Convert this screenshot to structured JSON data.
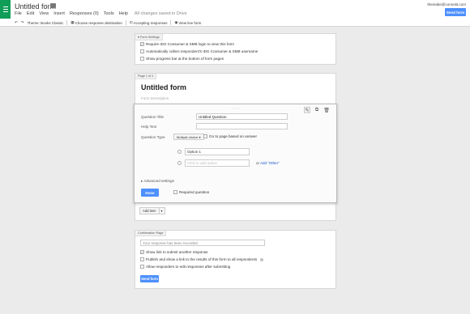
{
  "header": {
    "title": "Untitled form",
    "menu": [
      "File",
      "Edit",
      "View",
      "Insert",
      "Responses (0)",
      "Tools",
      "Help"
    ],
    "saved_status": "All changes saved in Drive",
    "user_email": "themabe@conso5t.com",
    "send_button": "Send form"
  },
  "toolbar": {
    "theme": "Theme: Books Classic",
    "destination": "Choose response destination",
    "accepting": "Accepting responses",
    "view_live": "View live form"
  },
  "settings": {
    "tab": "Form Settings",
    "options": [
      {
        "label": "Require IDG Consumer & SMB login to view this form",
        "checked": true
      },
      {
        "label": "Automatically collect respondent's IDG Consumer & SMB username",
        "checked": false
      },
      {
        "label": "Show progress bar at the bottom of form pages",
        "checked": false
      }
    ]
  },
  "form": {
    "page_tab": "Page 1 of 1",
    "title": "Untitled form",
    "description_placeholder": "Form Description"
  },
  "question": {
    "title_label": "Question Title",
    "title_value": "Untitled Question",
    "help_label": "Help Text",
    "help_value": "",
    "type_label": "Question Type",
    "type_value": "Multiple choice",
    "goto_label": "Go to page based on answer",
    "option1": "Option 1",
    "add_option_placeholder": "Click to add option",
    "or_text": "or",
    "add_other": "Add \"Other\"",
    "advanced": "Advanced settings",
    "done": "Done",
    "required": "Required question"
  },
  "add_item": "Add item",
  "confirmation": {
    "tab": "Confirmation Page",
    "message": "Your response has been recorded.",
    "options": [
      {
        "label": "Show link to submit another response",
        "checked": true
      },
      {
        "label": "Publish and show a link to the results of this form to all respondents",
        "checked": false
      },
      {
        "label": "Allow responders to edit responses after submitting",
        "checked": false
      }
    ],
    "send_button": "Send form"
  },
  "colors": {
    "accent": "#4d90fe",
    "app_green": "#0f9d58"
  }
}
